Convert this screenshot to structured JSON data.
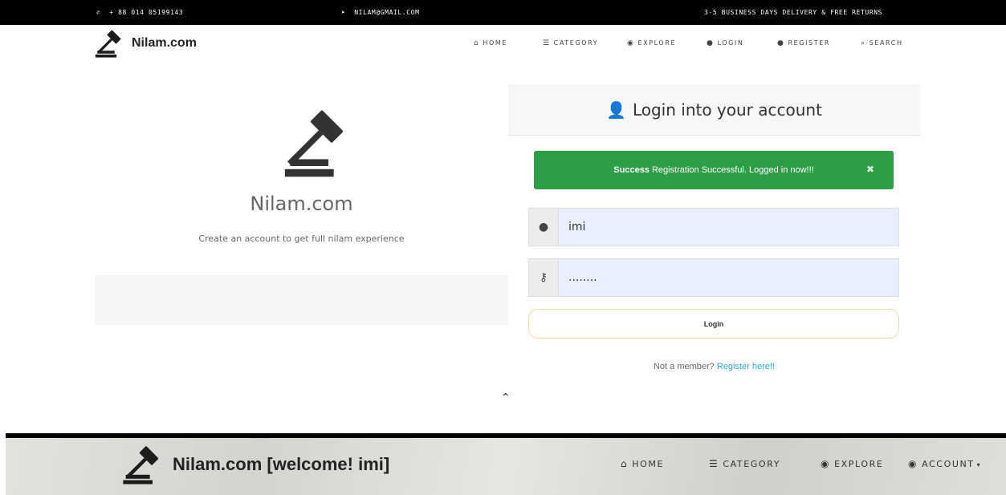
{
  "topbar": {
    "phone": "+ 88 014 05199143",
    "email": "NILAM@GMAIL.COM",
    "shipping": "3-5 BUSINESS DAYS DELIVERY & FREE RETURNS"
  },
  "brand": {
    "name": "Nilam.com"
  },
  "nav": [
    {
      "label": "HOME",
      "icon": "home-icon",
      "glyph": "🏠"
    },
    {
      "label": "CATEGORY",
      "icon": "list-icon",
      "glyph": "☰"
    },
    {
      "label": "EXPLORE",
      "icon": "compass-icon",
      "glyph": "🧭"
    },
    {
      "label": "LOGIN",
      "icon": "user-login-icon",
      "glyph": "👤"
    },
    {
      "label": "REGISTER",
      "icon": "user-add-icon",
      "glyph": "👥"
    },
    {
      "label": "SEARCH",
      "icon": "search-icon",
      "glyph": "🔍"
    }
  ],
  "left": {
    "title": "Nilam.com",
    "subtitle": "Create an account to get full nilam experience"
  },
  "login": {
    "heading": "Login into your account",
    "alert_strong": "Success",
    "alert_text": "Registration Successful. Logged in now!!!",
    "username_value": "imi",
    "password_value": "........",
    "button_label": "Login",
    "member_text": "Not a member?",
    "register_link": "Register here!!"
  },
  "second_nav": {
    "brand": "Nilam.com",
    "welcome": "[welcome! imi]",
    "items": [
      {
        "label": "HOME",
        "icon": "home-icon"
      },
      {
        "label": "CATEGORY",
        "icon": "list-icon"
      },
      {
        "label": "EXPLORE",
        "icon": "compass-icon"
      },
      {
        "label": "ACCOUNT",
        "icon": "account-icon"
      }
    ]
  },
  "colors": {
    "success": "#2e9e46",
    "link": "#2aa9c9",
    "input_bg": "#e8f0fd",
    "button_border": "#f0d9a6"
  }
}
